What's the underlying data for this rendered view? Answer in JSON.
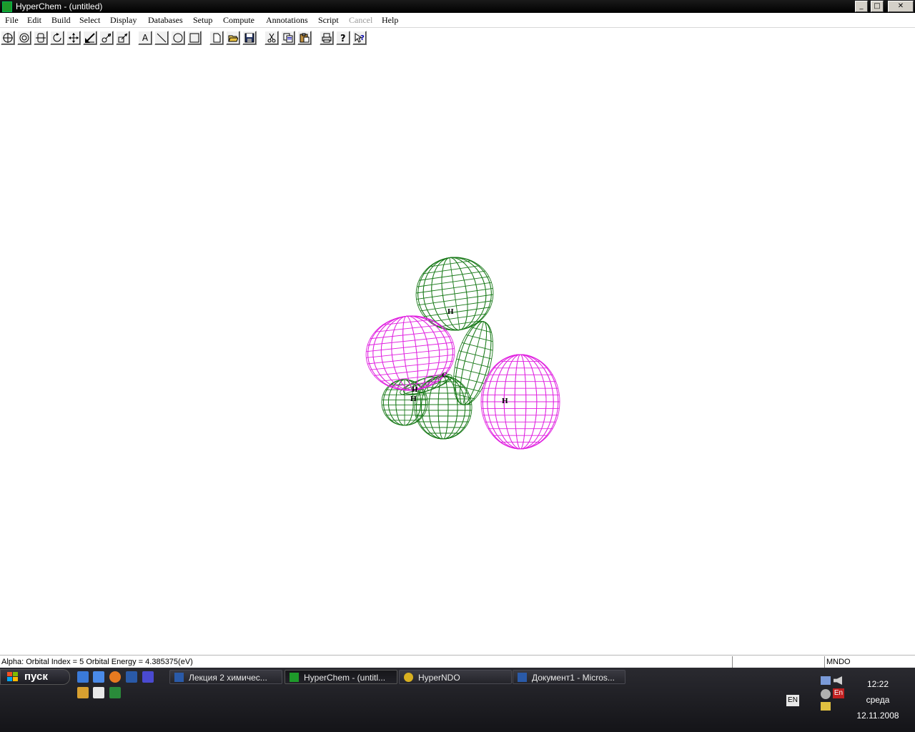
{
  "window": {
    "title": "HyperChem - (untitled)",
    "controls": {
      "minimize": "_",
      "maximize": "□",
      "close": "✕"
    }
  },
  "menu": {
    "items": [
      "File",
      "Edit",
      "Build",
      "Select",
      "Display",
      "Databases",
      "Setup",
      "Compute",
      "Annotations",
      "Script",
      "Cancel",
      "Help"
    ],
    "disabled": [
      "Cancel"
    ]
  },
  "toolbar": {
    "tools": [
      "draw-tool-icon",
      "select-tool-icon",
      "rotate-out-of-plane-icon",
      "rotate-in-plane-icon",
      "translate-icon",
      "z-translate-icon",
      "zoom-icon",
      "z-clip-icon",
      "text-annotation-icon",
      "line-annotation-icon",
      "ellipse-annotation-icon",
      "rectangle-annotation-icon",
      "new-file-icon",
      "open-file-icon",
      "save-file-icon",
      "cut-icon",
      "copy-icon",
      "paste-icon",
      "print-icon",
      "help-icon",
      "context-help-icon"
    ],
    "text_tool_glyph": "A"
  },
  "molecule": {
    "atom_labels": [
      "H",
      "C",
      "H",
      "H",
      "H"
    ],
    "colors": {
      "positive_lobe": "#1a7a1a",
      "negative_lobe": "#e020e0",
      "label": "#000000"
    }
  },
  "status": {
    "message": "Alpha: Orbital Index = 5 Orbital Energy = 4.385375(eV)",
    "field2": "",
    "method": "MNDO"
  },
  "taskbar": {
    "start_label": "пуск",
    "tasks": [
      {
        "label": "Лекция 2 химичес...",
        "active": false,
        "icon": "word-icon"
      },
      {
        "label": "HyperChem - (untitl...",
        "active": true,
        "icon": "hyperchem-icon"
      },
      {
        "label": "HyperNDO",
        "active": false,
        "icon": "hyperndo-icon"
      },
      {
        "label": "Документ1 - Micros...",
        "active": false,
        "icon": "word-icon"
      }
    ],
    "tray": {
      "lang_bar": "EN",
      "lang_indicator": "En",
      "time": "12:22",
      "day": "среда",
      "date": "12.11.2008"
    }
  }
}
